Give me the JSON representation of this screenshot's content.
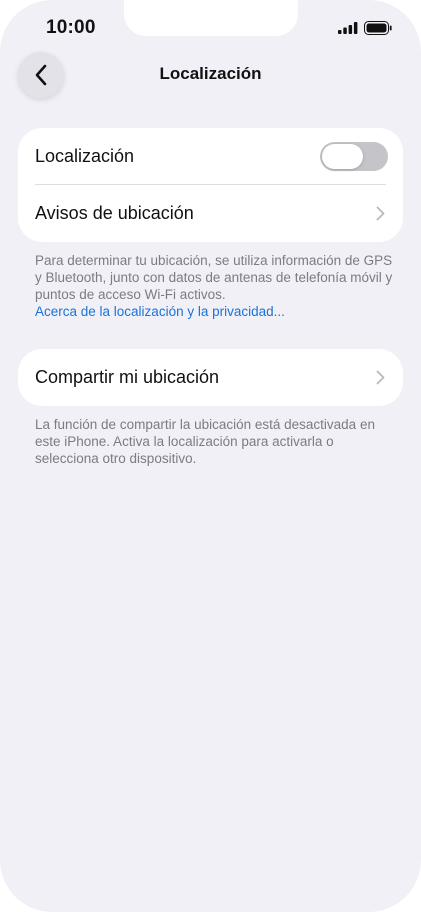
{
  "status_bar": {
    "time": "10:00",
    "signal_icon": "signal-bars-icon",
    "battery_icon": "battery-icon"
  },
  "nav": {
    "back_icon": "chevron-left-icon",
    "title": "Localización"
  },
  "location_card": {
    "toggle_label": "Localización",
    "toggle_on": false,
    "alerts_label": "Avisos de ubicación"
  },
  "location_footnote": {
    "text": "Para determinar tu ubicación, se utiliza información de GPS y Bluetooth, junto con datos de antenas de telefonía móvil y puntos de acceso Wi-Fi activos.",
    "link": "Acerca de la localización y la privacidad..."
  },
  "share_card": {
    "label": "Compartir mi ubicación"
  },
  "share_footnote": {
    "text": "La función de compartir la ubicación está desactivada en este iPhone. Activa la localización para activarla o selecciona otro dispositivo."
  },
  "colors": {
    "background": "#f1f0f6",
    "card": "#ffffff",
    "link": "#1a73d9",
    "toggle_off": "#c5c4c9"
  }
}
